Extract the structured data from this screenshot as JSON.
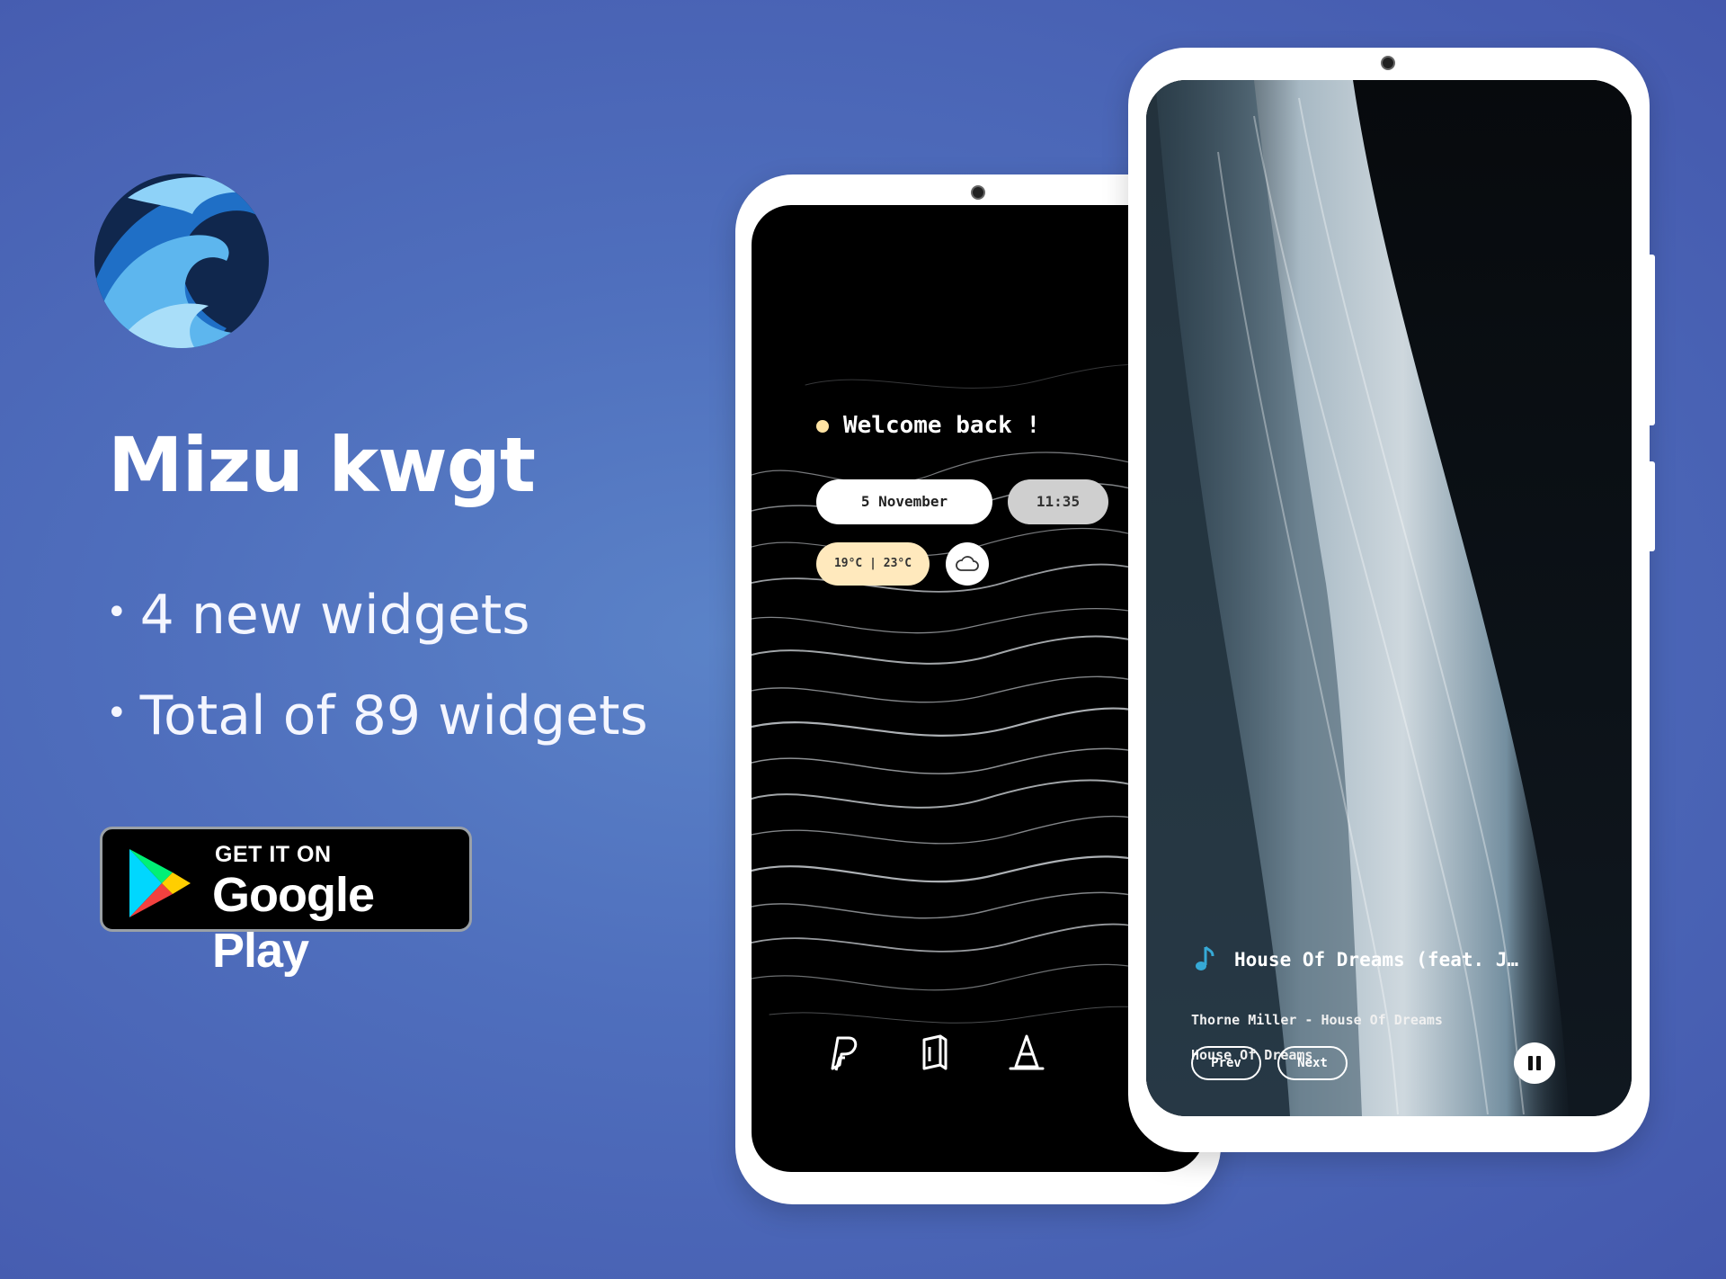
{
  "promo": {
    "title": "Mizu kwgt",
    "features": [
      "4 new widgets",
      "Total of 89 widgets"
    ]
  },
  "store_badge": {
    "small_text": "GET IT ON",
    "big_text": "Google Play"
  },
  "left_phone": {
    "greeting": "Welcome back !",
    "date": "5 November",
    "time": "11:35",
    "temperature": "19°C | 23°C",
    "weather_icon": "cloud-icon",
    "dock_icons": [
      "paypal-icon",
      "book-icon",
      "vlc-cone-icon"
    ]
  },
  "right_phone": {
    "track_title": "House Of Dreams (feat. J…",
    "artist_album": "Thorne Miller - House Of Dreams",
    "album": "House Of Dreams",
    "prev_label": "Prev",
    "next_label": "Next",
    "playback_icon": "pause-icon"
  },
  "colors": {
    "background": "#4f6fbd",
    "phone_frame": "#ffffff",
    "date_pill": "#ffffff",
    "time_pill": "#cfcfcf",
    "temp_pill": "#ffe9bd",
    "greeting_dot": "#ffe3a3",
    "music_note": "#36a9d6"
  }
}
